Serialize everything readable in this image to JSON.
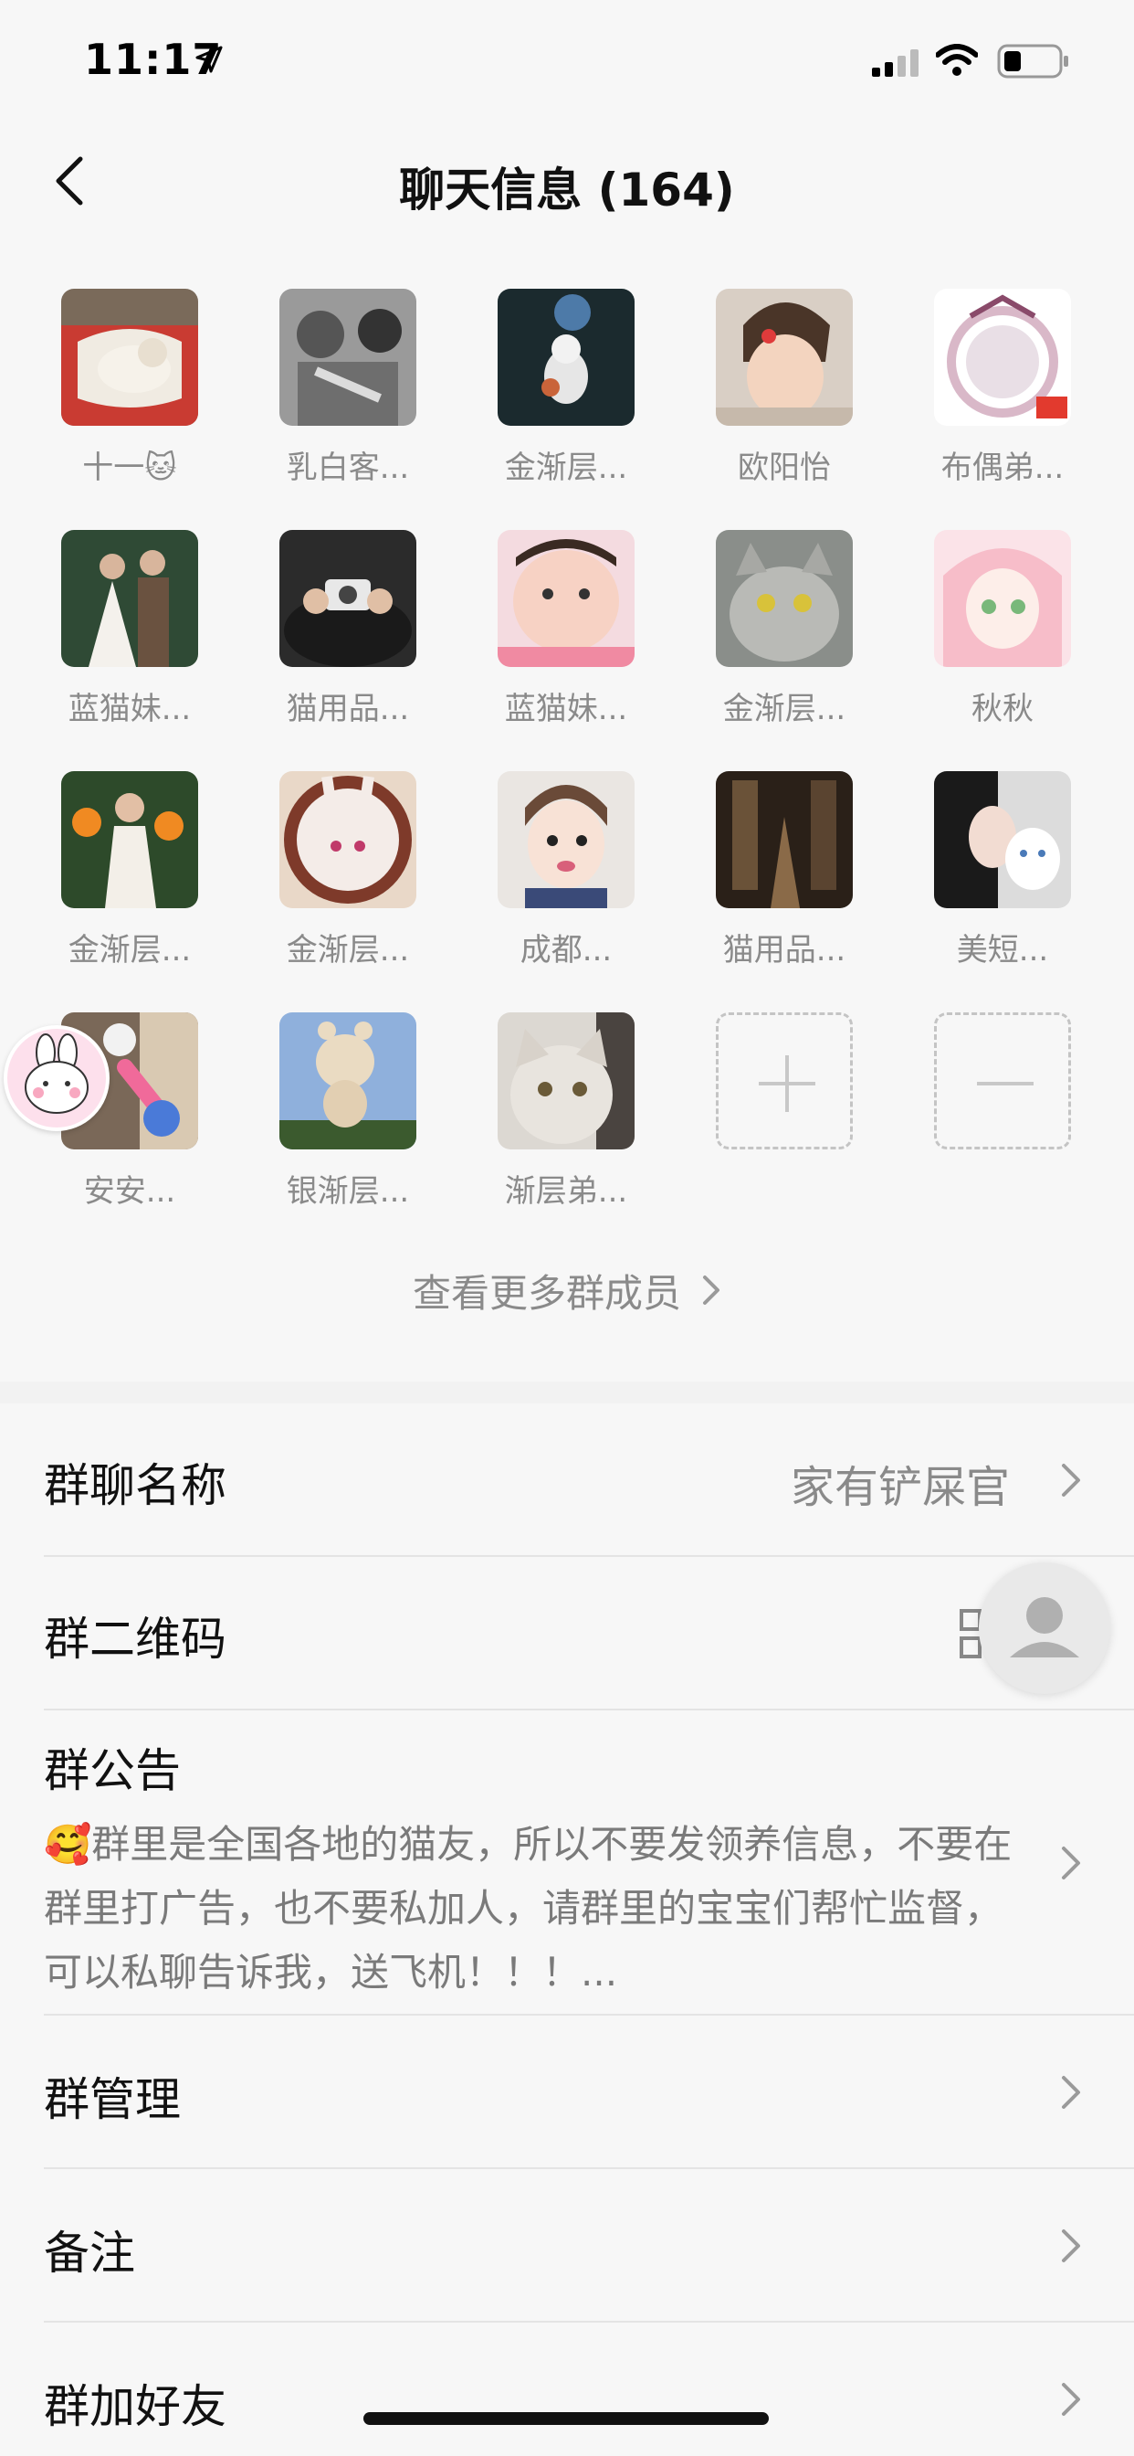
{
  "status_bar": {
    "time": "11:17"
  },
  "nav": {
    "title": "聊天信息 (164)"
  },
  "members": [
    {
      "name": "十一🐱"
    },
    {
      "name": "乳白客..."
    },
    {
      "name": "金渐层..."
    },
    {
      "name": "欧阳怡"
    },
    {
      "name": "布偶弟..."
    },
    {
      "name": "蓝猫妹..."
    },
    {
      "name": "猫用品..."
    },
    {
      "name": "蓝猫妹..."
    },
    {
      "name": "金渐层..."
    },
    {
      "name": "秋秋"
    },
    {
      "name": "金渐层..."
    },
    {
      "name": "金渐层..."
    },
    {
      "name": "成都..."
    },
    {
      "name": "猫用品..."
    },
    {
      "name": "美短..."
    },
    {
      "name": "安安..."
    },
    {
      "name": "银渐层..."
    },
    {
      "name": "渐层弟..."
    }
  ],
  "more_members_label": "查看更多群成员",
  "settings": {
    "group_name_label": "群聊名称",
    "group_name_value": "家有铲屎官",
    "qr_label": "群二维码",
    "notice_label": "群公告",
    "notice_text": "🥰群里是全国各地的猫友，所以不要发领养信息，不要在群里打广告，也不要私加人，请群里的宝宝们帮忙监督，可以私聊告诉我，送飞机！！！...",
    "manage_label": "群管理",
    "remark_label": "备注",
    "add_friends_label": "群加好友"
  },
  "colors": {
    "background": "#f7f7f7",
    "divider": "#e4e4e4",
    "secondary_text": "#8a8a8a"
  }
}
